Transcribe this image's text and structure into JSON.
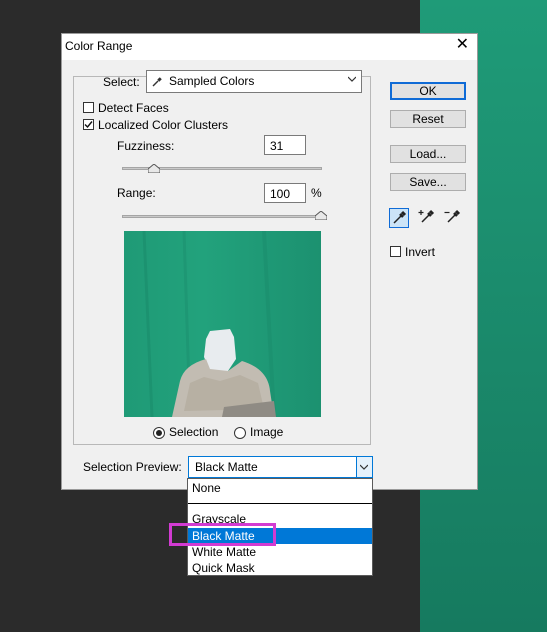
{
  "dialog": {
    "title": "Color Range",
    "close_glyph": "✕",
    "select_label": "Select:",
    "select_value": "Sampled Colors",
    "detect_faces_label": "Detect Faces",
    "detect_faces_checked": false,
    "localized_label": "Localized Color Clusters",
    "localized_checked": true,
    "fuzziness_label": "Fuzziness:",
    "fuzziness_value": "31",
    "range_label": "Range:",
    "range_value": "100",
    "range_unit": "%",
    "view_selection_label": "Selection",
    "view_image_label": "Image",
    "view_selected": "Selection",
    "selection_preview_label": "Selection Preview:",
    "selection_preview_value": "Black Matte",
    "buttons": {
      "ok": "OK",
      "reset": "Reset",
      "load": "Load...",
      "save": "Save..."
    },
    "invert_label": "Invert",
    "invert_checked": false
  },
  "dropdown": {
    "items": [
      "None",
      "Grayscale",
      "Black Matte",
      "White Matte",
      "Quick Mask"
    ],
    "selected": "Black Matte"
  },
  "colors": {
    "accent": "#0078d7",
    "annotation": "#d23bd2",
    "green_screen": "#1f9b78"
  }
}
